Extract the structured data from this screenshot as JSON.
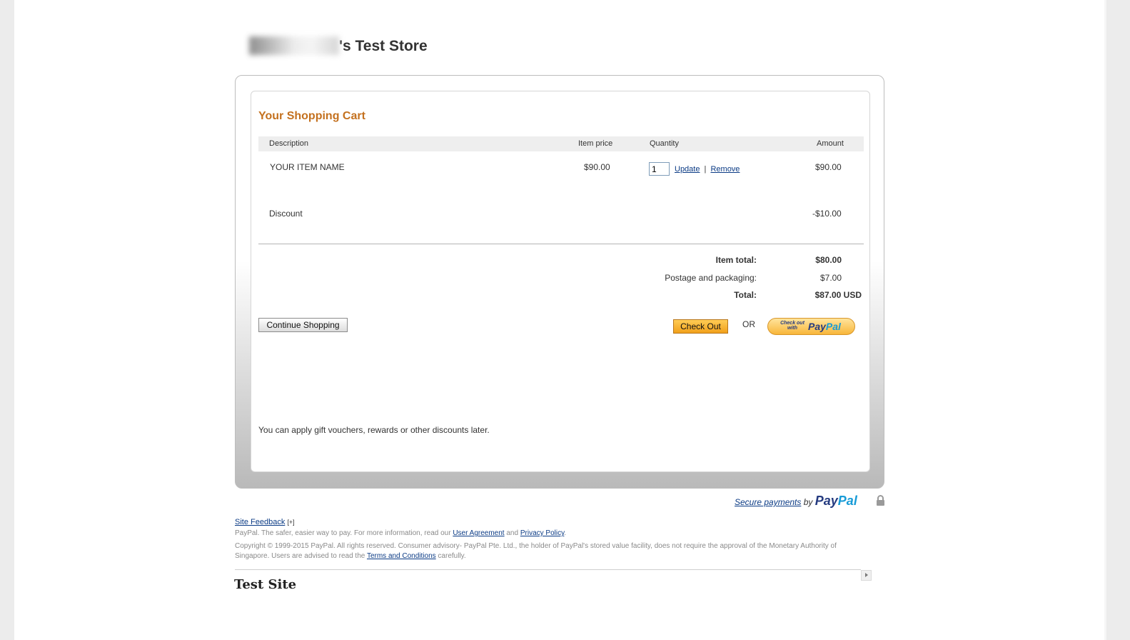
{
  "store": {
    "title_suffix": "'s Test Store"
  },
  "cart": {
    "heading": "Your Shopping Cart",
    "columns": {
      "description": "Description",
      "item_price": "Item price",
      "quantity": "Quantity",
      "amount": "Amount"
    },
    "item": {
      "name": "YOUR ITEM NAME",
      "price": "$90.00",
      "quantity": "1",
      "update_label": "Update",
      "separator": "|",
      "remove_label": "Remove",
      "amount": "$90.00"
    },
    "discount": {
      "label": "Discount",
      "amount": "-$10.00"
    },
    "totals": {
      "item_total_label": "Item total:",
      "item_total_value": "$80.00",
      "postage_label": "Postage and packaging:",
      "postage_value": "$7.00",
      "total_label": "Total:",
      "total_value": "$87.00 USD"
    },
    "continue_label": "Continue Shopping",
    "checkout_label": "Check Out",
    "or_label": "OR",
    "paypal_button": {
      "small": "Check out with",
      "pay": "Pay",
      "pal": "Pal"
    },
    "note": "You can apply gift vouchers, rewards or other discounts later."
  },
  "secure": {
    "text": "Secure payments",
    "by": "by",
    "pay": "Pay",
    "pal": "Pal"
  },
  "footer": {
    "feedback_label": "Site Feedback",
    "feedback_plus": "[+]",
    "line1_prefix": "PayPal. The safer, easier way to pay. For more information, read our ",
    "user_agreement": "User Agreement",
    "and": " and ",
    "privacy_policy": "Privacy Policy",
    "period": ".",
    "copyright_line1": "Copyright © 1999-2015 PayPal. All rights reserved. Consumer advisory- PayPal Pte. Ltd., the holder of PayPal's stored value facility, does not require the approval of the Monetary Authority of",
    "copyright_line2_prefix": "Singapore. Users are advised to read the ",
    "terms": "Terms and Conditions",
    "copyright_line2_suffix": " carefully.",
    "site_name": "Test Site"
  },
  "colors": {
    "heading": "#c4711f",
    "link": "#0b3b85",
    "paypal_dark": "#253b80",
    "paypal_light": "#179bd7"
  }
}
